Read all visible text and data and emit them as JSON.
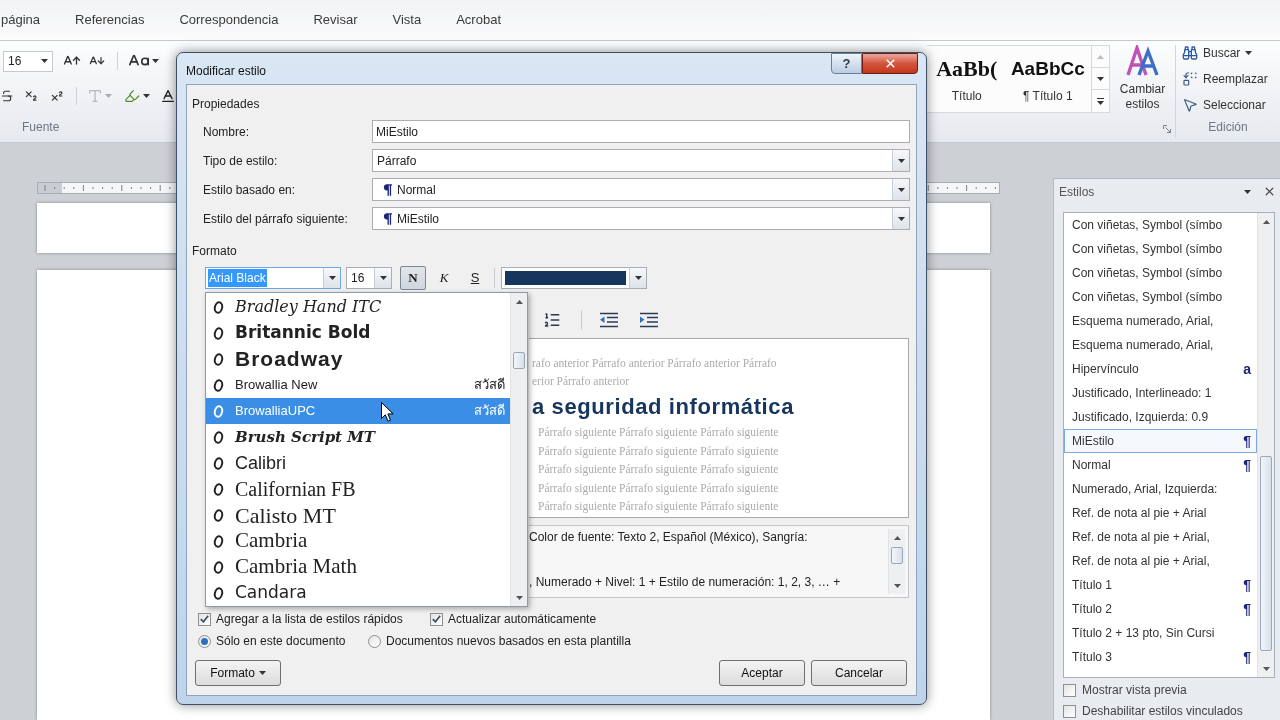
{
  "ribbon_tabs": [
    {
      "label": "página",
      "selected": false
    },
    {
      "label": "Referencias",
      "selected": false
    },
    {
      "label": "Correspondencia",
      "selected": false
    },
    {
      "label": "Revisar",
      "selected": false
    },
    {
      "label": "Vista",
      "selected": false
    },
    {
      "label": "Acrobat",
      "selected": false
    }
  ],
  "ribbon": {
    "font_group": {
      "size": "16",
      "label": "Fuente"
    },
    "styles_gallery": [
      {
        "sample": "AaBb(",
        "name": "Título"
      },
      {
        "sample": "AaBbCc",
        "name": "¶ Título 1"
      }
    ],
    "change_styles": {
      "label": "Cambiar estilos"
    },
    "editing": {
      "label": "Edición",
      "commands": [
        {
          "label": "Buscar",
          "kind": "find"
        },
        {
          "label": "Reemplazar",
          "kind": "replace"
        },
        {
          "label": "Seleccionar",
          "kind": "select"
        }
      ]
    }
  },
  "dialog": {
    "title": "Modificar estilo",
    "help_label": "?",
    "properties": {
      "heading": "Propiedades",
      "fields": [
        {
          "label": "Nombre:",
          "value": "MiEstilo",
          "kind": "text"
        },
        {
          "label": "Tipo de estilo:",
          "value": "Párrafo",
          "kind": "select"
        },
        {
          "label": "Estilo basado en:",
          "value": "Normal",
          "kind": "style_select"
        },
        {
          "label": "Estilo del párrafo siguiente:",
          "value": "MiEstilo",
          "kind": "style_select"
        }
      ]
    },
    "format": {
      "heading": "Formato",
      "font": "Arial Black",
      "size": "16",
      "toggles": [
        {
          "label": "N",
          "kind": "bold",
          "pressed": true
        },
        {
          "label": "K",
          "kind": "italic",
          "pressed": false
        },
        {
          "label": "S",
          "kind": "underline",
          "pressed": false
        }
      ],
      "font_list": [
        {
          "name": "Bradley Hand ITC",
          "selected": false
        },
        {
          "name": "Britannic Bold",
          "selected": false
        },
        {
          "name": "Broadway",
          "selected": false
        },
        {
          "name": "Browallia New",
          "sample": "สวัสดี",
          "selected": false
        },
        {
          "name": "BrowalliaUPC",
          "sample": "สวัสดี",
          "selected": true
        },
        {
          "name": "Brush Script MT",
          "selected": false
        },
        {
          "name": "Calibri",
          "selected": false
        },
        {
          "name": "Californian FB",
          "selected": false
        },
        {
          "name": "Calisto MT",
          "selected": false
        },
        {
          "name": "Cambria",
          "selected": false
        },
        {
          "name": "Cambria Math",
          "selected": false
        },
        {
          "name": "Candara",
          "selected": false
        }
      ],
      "preview": {
        "previous": [
          "rafo anterior Párrafo anterior Párrafo anterior Párrafo",
          "erior Párrafo anterior"
        ],
        "sample": "a seguridad informática",
        "following": [
          "Párrafo siguiente Párrafo siguiente Párrafo siguiente",
          "Párrafo siguiente Párrafo siguiente Párrafo siguiente",
          "Párrafo siguiente Párrafo siguiente Párrafo siguiente",
          "Párrafo siguiente Párrafo siguiente Párrafo siguiente",
          "Párrafo siguiente Párrafo siguiente Párrafo siguiente"
        ]
      },
      "description": [
        "Color de fuente: Texto 2, Español (México), Sangría:",
        ", Numerado + Nivel: 1 + Estilo de numeración: 1, 2, 3, … +"
      ]
    },
    "checkboxes": [
      {
        "label": "Agregar a la lista de estilos rápidos",
        "checked": true
      },
      {
        "label": "Actualizar automáticamente",
        "checked": true
      }
    ],
    "radios": [
      {
        "label": "Sólo en este documento",
        "selected": true
      },
      {
        "label": "Documentos nuevos basados en esta plantilla",
        "selected": false
      }
    ],
    "buttons": [
      {
        "label": "Formato",
        "kind": "menu"
      },
      {
        "label": "Aceptar",
        "kind": "push"
      },
      {
        "label": "Cancelar",
        "kind": "push"
      }
    ]
  },
  "styles_pane": {
    "title": "Estilos",
    "items": [
      {
        "label": "Con viñetas, Symbol (símbo",
        "selected": false
      },
      {
        "label": "Con viñetas, Symbol (símbo",
        "selected": false
      },
      {
        "label": "Con viñetas, Symbol (símbo",
        "selected": false
      },
      {
        "label": "Con viñetas, Symbol (símbo",
        "selected": false
      },
      {
        "label": "Esquema numerado, Arial,",
        "selected": false
      },
      {
        "label": "Esquema numerado, Arial,",
        "selected": false
      },
      {
        "label": "Hipervínculo",
        "mark": "a",
        "selected": false
      },
      {
        "label": "Justificado, Interlineado:  1",
        "selected": false
      },
      {
        "label": "Justificado, Izquierda:  0.9",
        "selected": false
      },
      {
        "label": "MiEstilo",
        "mark": "¶",
        "selected": true
      },
      {
        "label": "Normal",
        "mark": "¶",
        "selected": false
      },
      {
        "label": "Numerado, Arial, Izquierda:",
        "selected": false
      },
      {
        "label": "Ref. de nota al pie + Arial",
        "selected": false
      },
      {
        "label": "Ref. de nota al pie + Arial,",
        "selected": false
      },
      {
        "label": "Ref. de nota al pie + Arial,",
        "selected": false
      },
      {
        "label": "Título 1",
        "mark": "¶",
        "selected": false
      },
      {
        "label": "Título 2",
        "mark": "¶",
        "selected": false
      },
      {
        "label": "Título 2 + 13 pto, Sin Cursi",
        "selected": false
      },
      {
        "label": "Título 3",
        "mark": "¶",
        "selected": false
      }
    ],
    "options": [
      {
        "label": "Mostrar vista previa",
        "checked": false
      },
      {
        "label": "Deshabilitar estilos vinculados",
        "checked": false
      }
    ]
  }
}
